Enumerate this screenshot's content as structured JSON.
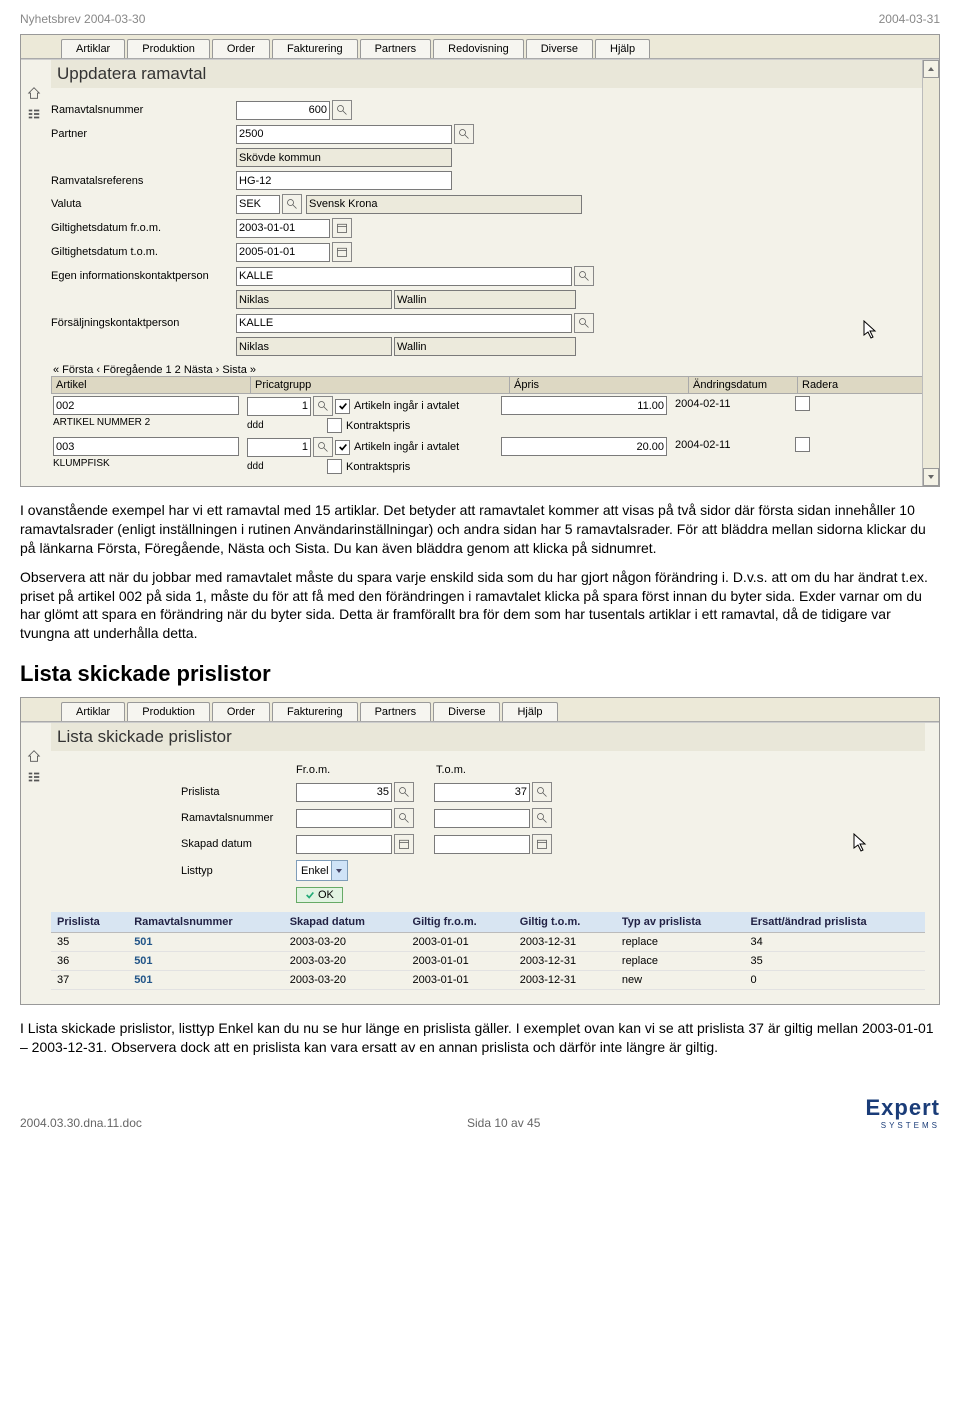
{
  "doc_header": {
    "left": "Nyhetsbrev 2004-03-30",
    "right": "2004-03-31"
  },
  "shot1": {
    "menu": [
      "Artiklar",
      "Produktion",
      "Order",
      "Fakturering",
      "Partners",
      "Redovisning",
      "Diverse",
      "Hjälp"
    ],
    "title": "Uppdatera ramavtal",
    "fields": {
      "f1_label": "Ramavtalsnummer",
      "f1_val": "600",
      "f2_label": "Partner",
      "f2_val": "2500",
      "f2b_val": "Skövde kommun",
      "f3_label": "Ramvatalsreferens",
      "f3_val": "HG-12",
      "f4_label": "Valuta",
      "f4_val": "SEK",
      "f4b_val": "Svensk Krona",
      "f5_label": "Giltighetsdatum fr.o.m.",
      "f5_val": "2003-01-01",
      "f6_label": "Giltighetsdatum t.o.m.",
      "f6_val": "2005-01-01",
      "f7_label": "Egen informationskontaktperson",
      "f7_val": "KALLE",
      "f7b_a": "Niklas",
      "f7b_b": "Wallin",
      "f8_label": "Försäljningskontaktperson",
      "f8_val": "KALLE",
      "f8b_a": "Niklas",
      "f8b_b": "Wallin"
    },
    "pager": "« Första ‹ Föregående 1 2 Nästa › Sista »",
    "grid_headers": {
      "c1": "Artikel",
      "c2": "Pricatgrupp",
      "c3": "Ápris",
      "c4": "Ändringsdatum",
      "c5": "Radera"
    },
    "row_labels": {
      "inc": "Artikeln ingår i avtalet",
      "kontrakt": "Kontraktspris"
    },
    "rows": [
      {
        "art": "002",
        "artname": "ARTIKEL NUMMER 2",
        "grp": "1",
        "grpname": "ddd",
        "pris": "11.00",
        "date": "2004-02-11"
      },
      {
        "art": "003",
        "artname": "KLUMPFISK",
        "grp": "1",
        "grpname": "ddd",
        "pris": "20.00",
        "date": "2004-02-11"
      }
    ]
  },
  "para1": "I ovanstående exempel har vi ett ramavtal med 15 artiklar. Det betyder att ramavtalet kommer att visas på två sidor där första sidan innehåller 10 ramavtalsrader (enligt inställningen i rutinen Användarinställningar) och andra sidan har 5 ramavtalsrader. För att bläddra mellan sidorna klickar du på länkarna Första, Föregående, Nästa och Sista. Du kan även bläddra genom att klicka på sidnumret.",
  "para2": "Observera att när du jobbar med ramavtalet måste du spara varje enskild sida som du har gjort någon förändring i. D.v.s. att om du har ändrat t.ex. priset på artikel 002 på sida 1, måste du för att få med den förändringen i ramavtalet klicka på spara först innan du byter sida. Exder varnar om du har glömt att spara en förändring när du byter sida. Detta är framförallt bra för dem som har tusentals artiklar i ett ramavtal, då de tidigare var tvungna att underhålla detta.",
  "section_heading": "Lista skickade prislistor",
  "shot2": {
    "menu": [
      "Artiklar",
      "Produktion",
      "Order",
      "Fakturering",
      "Partners",
      "Diverse",
      "Hjälp"
    ],
    "title": "Lista skickade prislistor",
    "col_from": "Fr.o.m.",
    "col_to": "T.o.m.",
    "filters": {
      "f1": "Prislista",
      "f1a": "35",
      "f1b": "37",
      "f2": "Ramavtalsnummer",
      "f2a": "",
      "f2b": "",
      "f3": "Skapad datum",
      "f3a": "",
      "f3b": "",
      "f4": "Listtyp",
      "f4val": "Enkel"
    },
    "ok": "OK",
    "thead": [
      "Prislista",
      "Ramavtalsnummer",
      "Skapad datum",
      "Giltig fr.o.m.",
      "Giltig t.o.m.",
      "Typ av prislista",
      "Ersatt/ändrad prislista"
    ],
    "rows": [
      {
        "c": [
          "35",
          "501",
          "2003-03-20",
          "2003-01-01",
          "2003-12-31",
          "replace",
          "34"
        ]
      },
      {
        "c": [
          "36",
          "501",
          "2003-03-20",
          "2003-01-01",
          "2003-12-31",
          "replace",
          "35"
        ]
      },
      {
        "c": [
          "37",
          "501",
          "2003-03-20",
          "2003-01-01",
          "2003-12-31",
          "new",
          "0"
        ]
      }
    ]
  },
  "para3": "I Lista skickade prislistor, listtyp Enkel kan du nu se hur länge en prislista gäller. I exemplet ovan kan vi se att prislista 37 är giltig mellan 2003-01-01 – 2003-12-31. Observera dock att en prislista kan vara ersatt av en annan prislista och därför inte längre är giltig.",
  "footer": {
    "left": "2004.03.30.dna.11.doc",
    "mid": "Sida 10 av 45",
    "logo_main": "Expert",
    "logo_sub": "SYSTEMS"
  }
}
